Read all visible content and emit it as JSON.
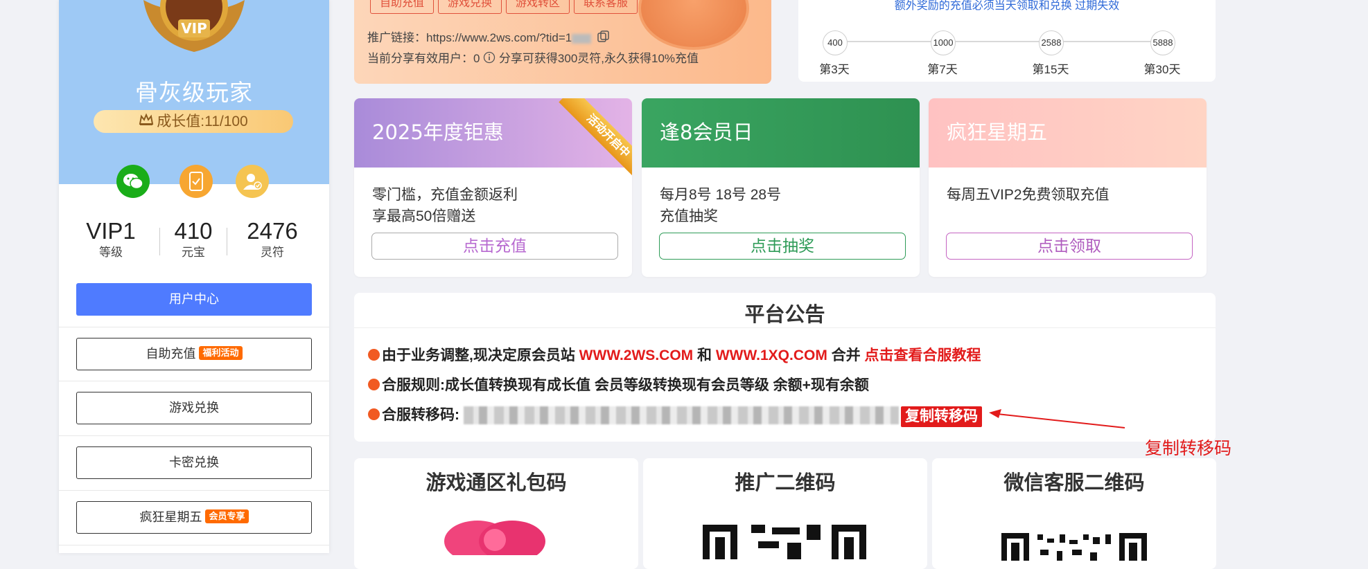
{
  "sidebar": {
    "player_title": "骨灰级玩家",
    "growth_label": "成长值:11/100",
    "icons": [
      "wechat-icon",
      "phone-check-icon",
      "user-verified-icon"
    ],
    "stats": [
      {
        "value": "VIP1",
        "label": "等级"
      },
      {
        "value": "410",
        "label": "元宝"
      },
      {
        "value": "2476",
        "label": "灵符"
      }
    ],
    "user_center": "用户中心",
    "buttons": [
      {
        "label": "自助充值",
        "tag": "福利活动"
      },
      {
        "label": "游戏兑换",
        "tag": ""
      },
      {
        "label": "卡密兑换",
        "tag": ""
      },
      {
        "label": "疯狂星期五",
        "tag": "会员专享"
      }
    ]
  },
  "promo": {
    "top_buttons": [
      "自助充值",
      "游戏兑换",
      "游戏转区",
      "联系客服"
    ],
    "link_label": "推广链接：https://www.2ws.com/?tid=1",
    "users_text": "当前分享有效用户：0",
    "users_note": "分享可获得300灵符,永久获得10%充值"
  },
  "streak": {
    "note": "额外奖励的充值必须当天领取和兑换 过期失效",
    "nodes": [
      {
        "value": "400",
        "day": "第3天"
      },
      {
        "value": "1000",
        "day": "第7天"
      },
      {
        "value": "2588",
        "day": "第15天"
      },
      {
        "value": "5888",
        "day": "第30天"
      }
    ]
  },
  "activities": [
    {
      "title": "2025年度钜惠",
      "desc1": "零门槛，充值金额返利",
      "desc2": "享最高50倍赠送",
      "button": "点击充值",
      "ribbon": "活动开启中"
    },
    {
      "title": "逢8会员日",
      "desc1": "每月8号 18号 28号",
      "desc2": "充值抽奖",
      "button": "点击抽奖"
    },
    {
      "title": "疯狂星期五",
      "desc1": "每周五VIP2免费领取充值",
      "desc2": "",
      "button": "点击领取"
    }
  ],
  "notice": {
    "title": "平台公告",
    "line1": {
      "a": "由于业务调整,现决定原会员站 ",
      "b": "WWW.2WS.COM",
      "c": " 和 ",
      "d": "WWW.1XQ.COM",
      "e": " 合并 ",
      "f": "点击查看合服教程"
    },
    "line2": "合服规则:成长值转换现有成长值 会员等级转换现有会员等级 余额+现有余额",
    "line3_label": "合服转移码:",
    "copy_button": "复制转移码",
    "annotation": "复制转移码"
  },
  "bottom_cards": [
    "游戏通区礼包码",
    "推广二维码",
    "微信客服二维码"
  ],
  "colors": {
    "accent_blue": "#4f7bff",
    "red": "#e21b1b",
    "orange_dot": "#f15a22",
    "green": "#2e9b57",
    "purple": "#b769d0"
  }
}
